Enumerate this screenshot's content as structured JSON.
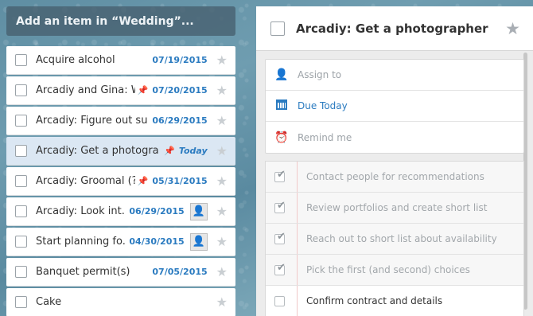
{
  "add_bar": {
    "placeholder": "Add an item in “Wedding”..."
  },
  "tasks": [
    {
      "title": "Acquire alcohol",
      "date": "07/19/2015",
      "pinned": false,
      "avatar": false,
      "selected": false
    },
    {
      "title": "Arcadiy and Gina: W.",
      "date": "07/20/2015",
      "pinned": true,
      "avatar": false,
      "selected": false
    },
    {
      "title": "Arcadiy: Figure out suit",
      "date": "06/29/2015",
      "pinned": false,
      "avatar": false,
      "selected": false
    },
    {
      "title": "Arcadiy: Get a photogra",
      "date": "Today",
      "pinned": true,
      "avatar": false,
      "selected": true
    },
    {
      "title": "Arcadiy: Groomal (?...",
      "date": "05/31/2015",
      "pinned": true,
      "avatar": false,
      "selected": false
    },
    {
      "title": "Arcadiy: Look int...",
      "date": "06/29/2015",
      "pinned": false,
      "avatar": true,
      "selected": false
    },
    {
      "title": "Start planning fo...",
      "date": "04/30/2015",
      "pinned": false,
      "avatar": true,
      "selected": false
    },
    {
      "title": "Banquet permit(s)",
      "date": "07/05/2015",
      "pinned": false,
      "avatar": false,
      "selected": false
    },
    {
      "title": "Cake",
      "date": "",
      "pinned": false,
      "avatar": false,
      "selected": false
    }
  ],
  "detail": {
    "title": "Arcadiy: Get a photographer",
    "assign_label": "Assign to",
    "due_label": "Due Today",
    "remind_label": "Remind me",
    "subtasks": [
      {
        "text": "Contact people for recommendations",
        "done": true
      },
      {
        "text": "Review portfolios and create short list",
        "done": true
      },
      {
        "text": "Reach out to short list about availability",
        "done": true
      },
      {
        "text": "Pick the first (and second) choices",
        "done": true
      },
      {
        "text": "Confirm contract and details",
        "done": false
      }
    ]
  },
  "colors": {
    "accent": "#2b7bc0",
    "selected_row": "#dbe7f3"
  },
  "icons": {
    "star": "star-icon",
    "pin": "pin-icon",
    "avatar": "avatar-icon",
    "assign": "assign-person-icon",
    "calendar": "calendar-icon",
    "alarm": "alarm-clock-icon",
    "check": "checkmark-icon"
  }
}
